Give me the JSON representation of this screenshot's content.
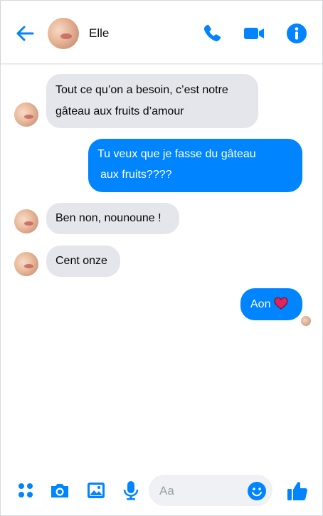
{
  "header": {
    "contact_name": "Elle",
    "icons": [
      "back-arrow-icon",
      "phone-icon",
      "video-camera-icon",
      "info-icon"
    ]
  },
  "messages": [
    {
      "direction": "incoming",
      "lines": [
        "Tout ce qu’on a besoin, c’est notre",
        "gâteau aux fruits d’amour"
      ]
    },
    {
      "direction": "outgoing",
      "lines": [
        "Tu veux que je fasse du gâteau",
        "aux fruits????"
      ]
    },
    {
      "direction": "incoming",
      "lines": [
        "Ben non, nounoune !"
      ]
    },
    {
      "direction": "incoming",
      "lines": [
        "Cent onze"
      ]
    },
    {
      "direction": "outgoing",
      "lines": [
        "Aon"
      ],
      "emoji": "red-heart-icon"
    }
  ],
  "composer": {
    "placeholder": "Aa",
    "icons": [
      "apps-grid-icon",
      "camera-icon",
      "image-icon",
      "microphone-icon",
      "emoji-icon",
      "thumbs-up-icon"
    ]
  },
  "colors": {
    "accent": "#0084ff",
    "incoming_bubble": "#e4e6eb",
    "heart": "#e0245e"
  }
}
